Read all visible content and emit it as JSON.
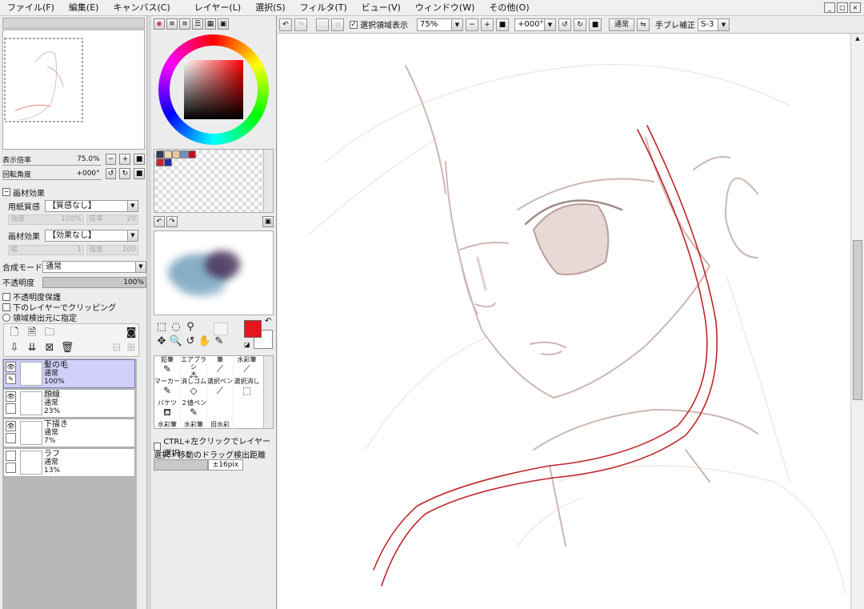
{
  "menu": [
    "ファイル(F)",
    "編集(E)",
    "キャンバス(C)",
    "レイヤー(L)",
    "選択(S)",
    "フィルタ(T)",
    "ビュー(V)",
    "ウィンドウ(W)",
    "その他(O)"
  ],
  "window_buttons": {
    "min": "_",
    "max": "□",
    "close": "×"
  },
  "toolbar": {
    "selection_show_label": "選択領域表示",
    "selection_show_checked": "✓",
    "zoom_value": "75%",
    "rotate_value": "+000°",
    "blend_label": "通常",
    "stabilizer_label": "手ブレ補正",
    "stabilizer_value": "S-3"
  },
  "navigator": {
    "zoom_label": "表示倍率",
    "zoom_value": "75.0%",
    "rotate_label": "回転角度",
    "rotate_value": "+000°"
  },
  "material": {
    "section_title": "画材効果",
    "paper_label": "用紙質感",
    "paper_value": "【質感なし】",
    "paper_strength_label": "強度",
    "paper_strength_value": "100%",
    "paper_scale_label": "倍率",
    "paper_scale_value": "20",
    "effect_label": "画材効果",
    "effect_value": "【効果なし】",
    "effect_width_label": "幅",
    "effect_width_value": "1",
    "effect_strength_label": "強度",
    "effect_strength_value": "100"
  },
  "layer_props": {
    "blend_label": "合成モード",
    "blend_value": "通常",
    "opacity_label": "不透明度",
    "opacity_value": "100%",
    "protect_label": "不透明度保護",
    "clip_label": "下のレイヤーでクリッピング",
    "source_label": "領域検出元に指定"
  },
  "layers": [
    {
      "name": "髪の毛",
      "mode": "通常",
      "opacity": "100%",
      "active": true
    },
    {
      "name": "顔線",
      "mode": "通常",
      "opacity": "23%",
      "active": false
    },
    {
      "name": "下描き",
      "mode": "通常",
      "opacity": "7%",
      "active": false
    },
    {
      "name": "ラフ",
      "mode": "通常",
      "opacity": "13%",
      "active": false
    }
  ],
  "colors": {
    "current": "#e8141e",
    "swatches": [
      "#3a3a5a",
      "#f0d8b0",
      "#e8c8a0",
      "#7090c0",
      "#c01020",
      "#d02030",
      "#2030a0"
    ]
  },
  "tools": [
    {
      "name": "鉛筆",
      "icon": "✎"
    },
    {
      "name": "エアブラシ",
      "icon": "⁂"
    },
    {
      "name": "筆",
      "icon": "⟋"
    },
    {
      "name": "水彩筆",
      "icon": "⟋"
    },
    {
      "name": "マーカー",
      "icon": "✎"
    },
    {
      "name": "消しゴム",
      "icon": "◇"
    },
    {
      "name": "選択ペン",
      "icon": "⟋"
    },
    {
      "name": "選択消し",
      "icon": "⬚"
    },
    {
      "name": "バケツ",
      "icon": "⛾"
    },
    {
      "name": "２値ペン",
      "icon": "✎"
    },
    {
      "name": "",
      "icon": ""
    },
    {
      "name": "",
      "icon": ""
    },
    {
      "name": "水彩筆",
      "icon": ""
    },
    {
      "name": "水彩筆",
      "icon": ""
    },
    {
      "name": "旧水彩",
      "icon": ""
    },
    {
      "name": "",
      "icon": ""
    }
  ],
  "tool_options": {
    "ctrl_click_label": "CTRL+左クリックでレイヤー選択",
    "drag_label": "選択・移動のドラッグ検出距離",
    "drag_value": "±16pix"
  }
}
